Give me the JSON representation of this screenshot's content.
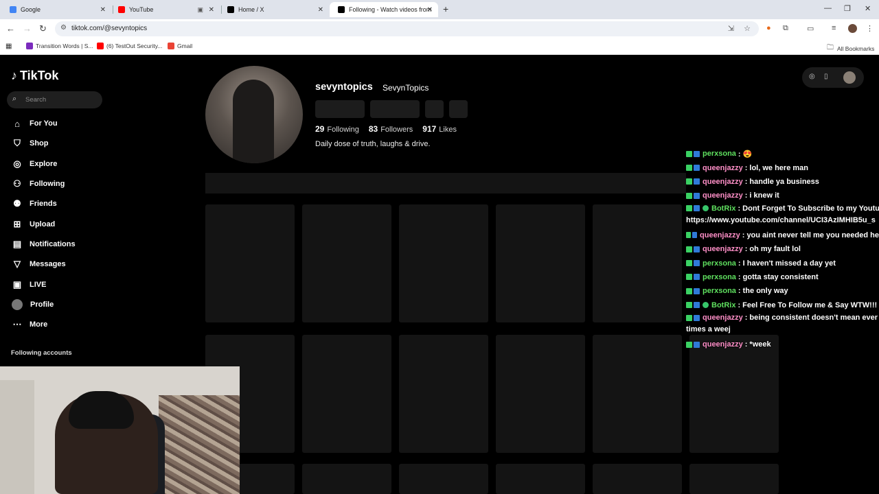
{
  "browser": {
    "tabs": [
      {
        "title": "Google",
        "color": "#4285f4"
      },
      {
        "title": "YouTube",
        "color": "#ff0000"
      },
      {
        "title": "Home / X",
        "color": "#000000"
      },
      {
        "title": "Following - Watch videos from",
        "color": "#000000"
      }
    ],
    "url": "tiktok.com/@sevyntopics",
    "bookmarks": [
      {
        "label": "Transition Words | S...",
        "color": "#7b2bbd"
      },
      {
        "label": "(6) TestOut Security...",
        "color": "#ff0000"
      },
      {
        "label": "Gmail",
        "color": "#ea4335"
      }
    ],
    "all_bookmarks": "All Bookmarks"
  },
  "sidebar": {
    "logo": "TikTok",
    "search_placeholder": "Search",
    "nav": [
      {
        "label": "For You",
        "icon": "home-icon"
      },
      {
        "label": "Shop",
        "icon": "shop-icon"
      },
      {
        "label": "Explore",
        "icon": "compass-icon"
      },
      {
        "label": "Following",
        "icon": "following-icon"
      },
      {
        "label": "Friends",
        "icon": "friends-icon"
      },
      {
        "label": "Upload",
        "icon": "upload-icon"
      },
      {
        "label": "Notifications",
        "icon": "inbox-icon"
      },
      {
        "label": "Messages",
        "icon": "messages-icon"
      },
      {
        "label": "LIVE",
        "icon": "live-icon"
      },
      {
        "label": "Profile",
        "icon": "profile-avatar"
      },
      {
        "label": "More",
        "icon": "more-icon"
      }
    ],
    "following_accounts": "Following accounts"
  },
  "profile": {
    "username": "sevyntopics",
    "display_name": "SevynTopics",
    "following_count": "29",
    "following_label": "Following",
    "followers_count": "83",
    "followers_label": "Followers",
    "likes_count": "917",
    "likes_label": "Likes",
    "bio": "Daily dose of truth, laughs & drive."
  },
  "chat": [
    {
      "user": "perxsona",
      "color": "#5fe05f",
      "text": ": 😍"
    },
    {
      "user": "queenjazzy",
      "color": "#ff8fc8",
      "text": ": lol, we here man"
    },
    {
      "user": "queenjazzy",
      "color": "#ff8fc8",
      "text": ": handle ya business"
    },
    {
      "user": "queenjazzy",
      "color": "#ff8fc8",
      "text": ": i knew it"
    },
    {
      "user": "BotRix",
      "color": "#5fe05f",
      "text": ": Dont Forget To Subscribe to my Youtu",
      "line2": "https://www.youtube.com/channel/UCI3AzIMHIB5u_s",
      "verified": true
    },
    {
      "user": "queenjazzy",
      "color": "#ff8fc8",
      "text": ": you aint never tell me you needed he"
    },
    {
      "user": "queenjazzy",
      "color": "#ff8fc8",
      "text": ": oh my fault lol"
    },
    {
      "user": "perxsona",
      "color": "#5fe05f",
      "text": ": I haven't missed a day yet"
    },
    {
      "user": "perxsona",
      "color": "#5fe05f",
      "text": ": gotta stay consistent"
    },
    {
      "user": "perxsona",
      "color": "#5fe05f",
      "text": ": the only way"
    },
    {
      "user": "BotRix",
      "color": "#5fe05f",
      "text": ": Feel Free To Follow me & Say WTW!!!",
      "verified": true
    },
    {
      "user": "queenjazzy",
      "color": "#ff8fc8",
      "text": ": being consistent doesn't mean ever",
      "line2": "times a weej"
    },
    {
      "user": "queenjazzy",
      "color": "#ff8fc8",
      "text": ": *week"
    }
  ]
}
